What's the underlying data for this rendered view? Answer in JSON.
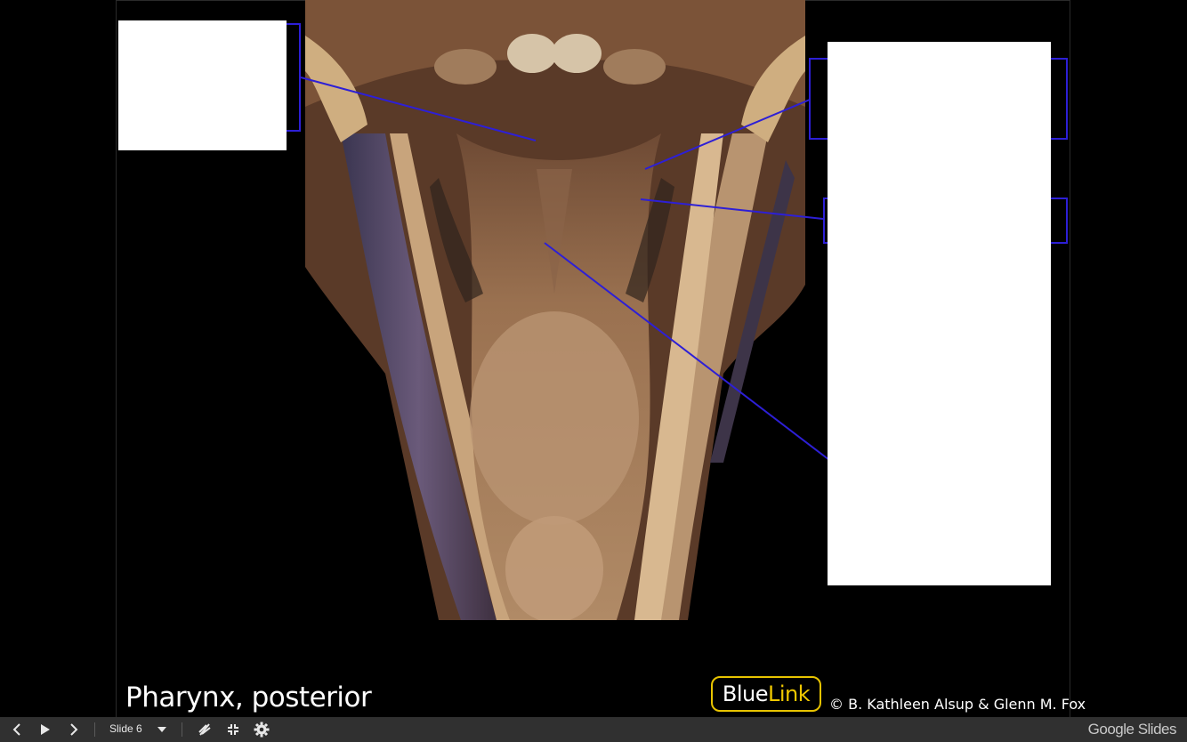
{
  "slide": {
    "caption": "Pharynx, posterior",
    "logo": {
      "part1": "Blue",
      "part2": "Link"
    },
    "copyright": "© B. Kathleen Alsup & Glenn M. Fox",
    "colors": {
      "leader_line": "#2d1fd6",
      "logo_border": "#e8c400",
      "logo_link_text": "#f0c800",
      "background": "#000000"
    }
  },
  "toolbar": {
    "slide_label": "Slide 6",
    "brand_part1": "Google",
    "brand_part2": " Slides",
    "icons": [
      "chevron-left-icon",
      "play-icon",
      "chevron-right-icon",
      "dropdown-caret-icon",
      "laser-pointer-icon",
      "exit-fullscreen-icon",
      "gear-icon"
    ]
  }
}
